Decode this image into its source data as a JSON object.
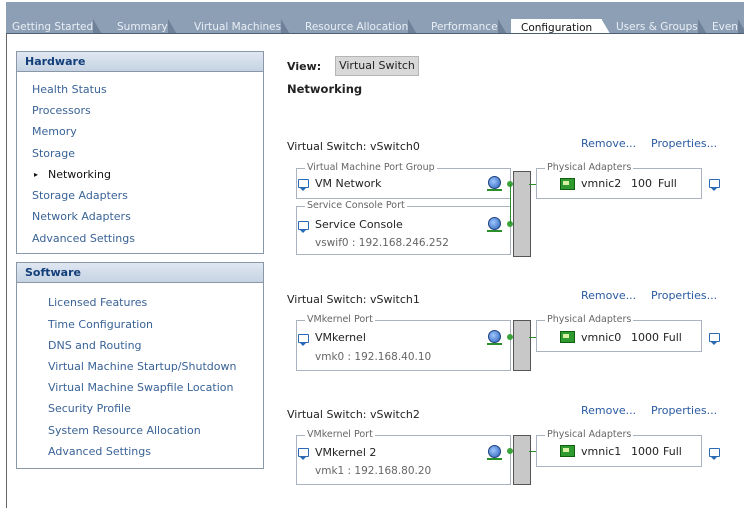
{
  "tabs": [
    "Getting Started",
    "Summary",
    "Virtual Machines",
    "Resource Allocation",
    "Performance",
    "Configuration",
    "Users & Groups",
    "Even"
  ],
  "active_tab": "Configuration",
  "hardware": {
    "title": "Hardware",
    "items": [
      "Health Status",
      "Processors",
      "Memory",
      "Storage",
      "Networking",
      "Storage Adapters",
      "Network Adapters",
      "Advanced Settings"
    ],
    "selected": "Networking"
  },
  "software": {
    "title": "Software",
    "items": [
      "Licensed Features",
      "Time Configuration",
      "DNS and Routing",
      "Virtual Machine Startup/Shutdown",
      "Virtual Machine Swapfile Location",
      "Security Profile",
      "System Resource Allocation",
      "Advanced Settings"
    ]
  },
  "view": {
    "label": "View:",
    "value": "Virtual Switch"
  },
  "section_title": "Networking",
  "links": {
    "remove": "Remove...",
    "properties": "Properties..."
  },
  "switches": [
    {
      "name": "Virtual Switch: vSwitch0",
      "port_groups": [
        {
          "group_label": "Virtual Machine Port Group",
          "name": "VM Network",
          "detail": ""
        },
        {
          "group_label": "Service Console Port",
          "name": "Service Console",
          "detail": "vswif0 : 192.168.246.252"
        }
      ],
      "adapters_label": "Physical Adapters",
      "adapter": {
        "name": "vmnic2",
        "speed": "100",
        "duplex": "Full"
      }
    },
    {
      "name": "Virtual Switch: vSwitch1",
      "port_groups": [
        {
          "group_label": "VMkernel Port",
          "name": "VMkernel",
          "detail": "vmk0 : 192.168.40.10"
        }
      ],
      "adapters_label": "Physical Adapters",
      "adapter": {
        "name": "vmnic0",
        "speed": "1000",
        "duplex": "Full"
      }
    },
    {
      "name": "Virtual Switch: vSwitch2",
      "port_groups": [
        {
          "group_label": "VMkernel Port",
          "name": "VMkernel 2",
          "detail": "vmk1 : 192.168.80.20"
        }
      ],
      "adapters_label": "Physical Adapters",
      "adapter": {
        "name": "vmnic1",
        "speed": "1000",
        "duplex": "Full"
      }
    }
  ]
}
